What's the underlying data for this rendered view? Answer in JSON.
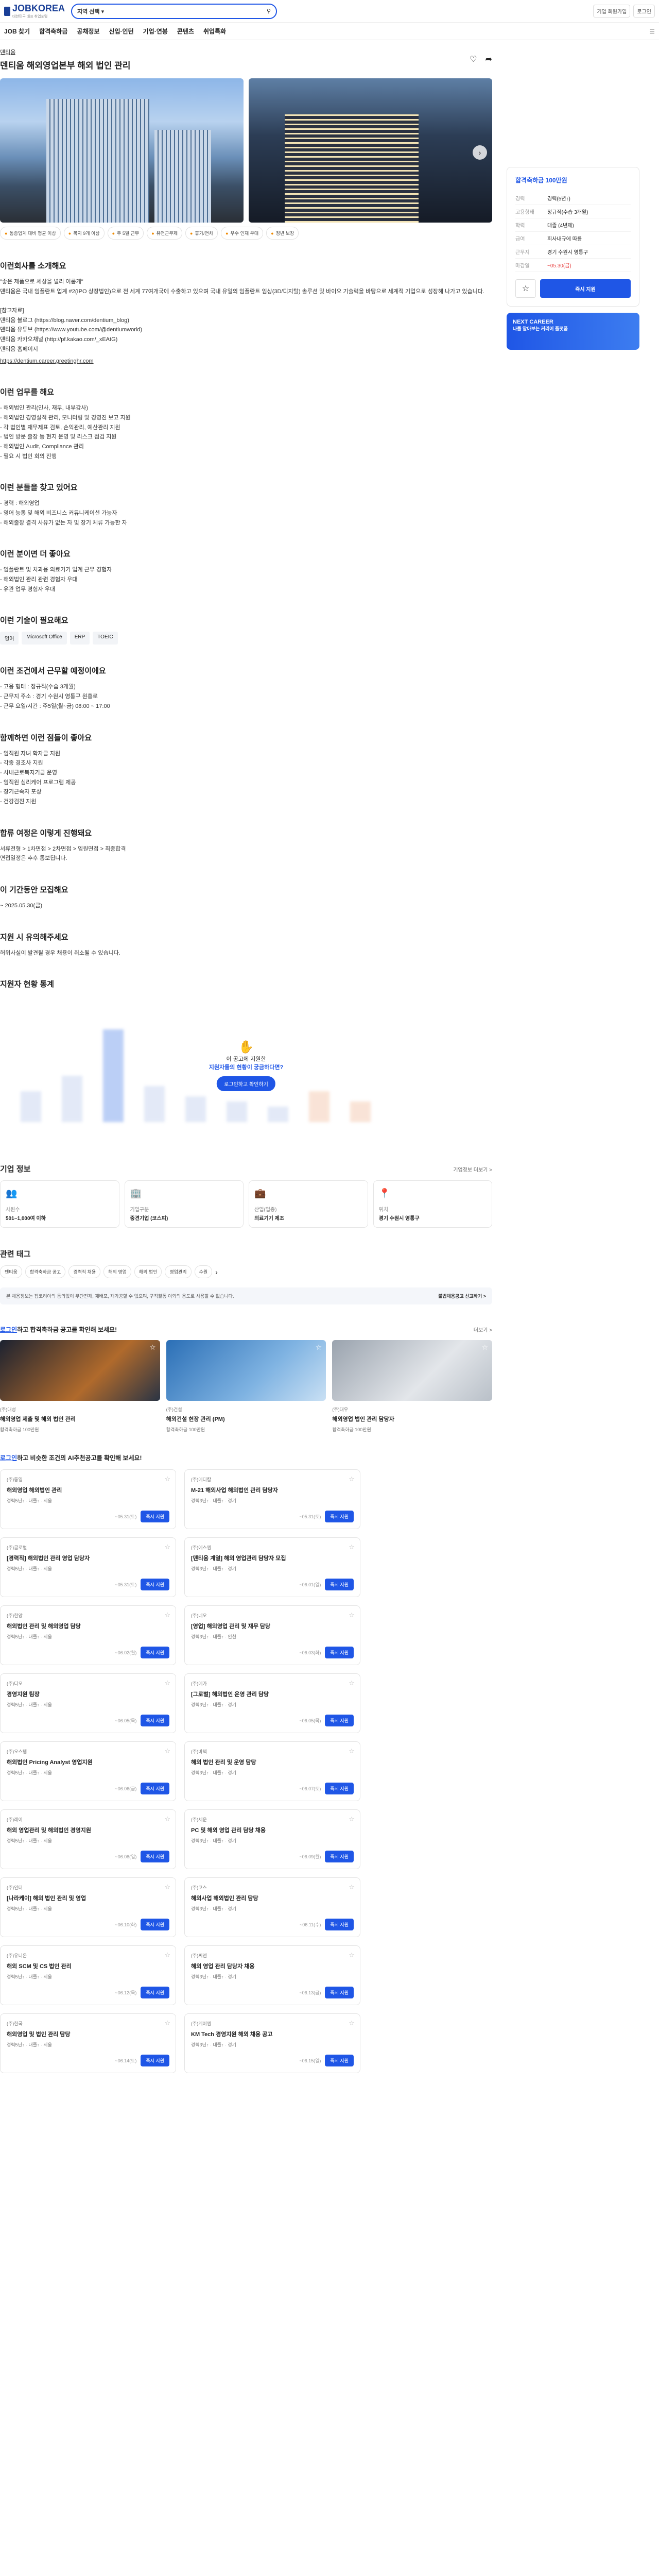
{
  "header": {
    "logo_text": "JOBKOREA",
    "logo_sub": "대한민국 대표 취업포털",
    "search_select": "지역 선택",
    "search_placeholder": "",
    "right_buttons": [
      "기업 회원가입",
      "로그인"
    ]
  },
  "gnb": [
    "JOB 찾기",
    "합격축하금",
    "공채정보",
    "신입·인턴",
    "기업·연봉",
    "콘텐츠",
    "취업특화"
  ],
  "job": {
    "company": "덴티움",
    "title": "덴티움 해외영업본부 해외 법인 관리",
    "tags": [
      "동종업계 대비 평균 이상",
      "복지 9개 이상",
      "주 5일 근무",
      "유연근무제",
      "휴가/연차",
      "우수 인재 우대",
      "정년 보장"
    ]
  },
  "summary": {
    "badge": "합격축하금 100만원",
    "rows": [
      {
        "k": "경력",
        "v": "경력(5년↑)"
      },
      {
        "k": "고용형태",
        "v": "정규직(수습 3개월)"
      },
      {
        "k": "학력",
        "v": "대졸 (4년제)"
      },
      {
        "k": "급여",
        "v": "회사내규에 따름"
      },
      {
        "k": "근무지",
        "v": "경기 수원시 영통구"
      },
      {
        "k": "마감일",
        "v": "~05.30(금)"
      }
    ],
    "apply_label": "즉시 지원",
    "banner_title": "NEXT CAREER",
    "banner_sub": "나를 알아보는 커리어 플랫폼"
  },
  "sections": {
    "intro_title": "이런회사를 소개해요",
    "intro_text": "\"좋은 제품으로 세상을 널리 이롭게\"\n덴티움은 국내 임플란트 업계 #2(IPO 상장법인)으로 전 세계 77여개국에 수출하고 있으며 국내 유일의 임플란트 임상(3D/디지털) 솔루션 및 바이오 기술력을 바탕으로 세계적 기업으로 성장해 나가고 있습니다.\n\n[참고자료]\n덴티움 블로그 (https://blog.naver.com/dentium_blog)\n덴티움 유튜브 (https://www.youtube.com/@dentiumworld)\n덴티움 카카오채널 (http://pf.kakao.com/_xEAtG)\n덴티움 홈페이지",
    "intro_link": "https://dentium.career.greetinghr.com",
    "duty_title": "이런 업무를 해요",
    "duty_text": "- 해외법인 관리(인사, 재무, 내부감사)\n - 해외법인 경영실적 관리, 모니터링 및 경영진 보고 지원\n - 각 법인별 재무제표 검토, 손익관리, 예산관리 지원\n - 법인 방문 출장 등 현지 운영 및 리스크 점검 지원\n - 해외법인 Audit, Compliance 관리\n - 필요 시 법인 회의 진행",
    "find_title": "이런 분들을 찾고 있어요",
    "find_text": "- 경력 : 해외영업\n - 영어 능통 및 해외 비즈니스 커뮤니케이션 가능자\n - 해외출장 결격 사유가 없는 자 및 장기 체류 가능한 자",
    "plus_title": "이런 분이면 더 좋아요",
    "plus_text": "- 임플란트 및 치과용 의료기기 업계 근무 경험자\n - 해외법인 관리 관련 경험자 우대\n - 유관 업무 경험자 우대",
    "skill_title": "이런 기술이 필요해요",
    "skills": [
      "영어",
      "Microsoft Office",
      "ERP",
      "TOEIC"
    ],
    "cond_title": "이런 조건에서 근무할 예정이에요",
    "cond_text": "- 고용 형태 : 정규직(수습 3개월)\n - 근무지 주소 : 경기 수원시 영통구 원흥로\n - 근무 요일/시간 : 주5일(월~금) 08:00 ~ 17:00",
    "benefit_title": "함께하면 이런 점들이 좋아요",
    "benefit_text": "- 임직원 자녀 학자금 지원\n - 각종 경조사 지원\n - 사내근로복지기금 운영\n - 임직원 심리케어 프로그램 제공\n - 장기근속자 포상\n - 건강검진 지원",
    "process_title": "합류 여정은 이렇게 진행돼요",
    "process_text": "서류전형 > 1차면접 > 2차면접 > 임원면접 > 최종합격\n면접일정은 추후 통보됩니다.",
    "deadline_title": "이 기간동안 모집해요",
    "deadline_text": "~ 2025.05.30(금)",
    "caution_title": "지원 시 유의해주세요",
    "caution_text": "허위사실이 발견될 경우 채용이 취소될 수 있습니다."
  },
  "stats": {
    "title": "지원자 현황 통계",
    "overlay_line1": "이 공고에 지원한",
    "overlay_line2": "지원자들의 현황이 궁금하다면?",
    "overlay_btn": "로그인하고 확인하기"
  },
  "company_info": {
    "title": "기업 정보",
    "more": "기업정보 더보기 >",
    "cards": [
      {
        "icon": "people-icon",
        "label": "사원수",
        "value": "501~1,000여 이하"
      },
      {
        "icon": "building-icon",
        "label": "기업구분",
        "value": "중견기업 (코스피)"
      },
      {
        "icon": "bag-icon",
        "label": "산업(업종)",
        "value": "의료기기 제조"
      },
      {
        "icon": "pin-icon",
        "label": "위치",
        "value": "경기 수원시 영통구"
      }
    ]
  },
  "related_tags": {
    "title": "관련 태그",
    "items": [
      "덴티움",
      "합격축하금 공고",
      "경력직 채용",
      "해외 영업",
      "해외 법인",
      "영업관리",
      "수원"
    ]
  },
  "notice": {
    "text": "본 채용정보는 잡코리아의 동의없이 무단전재, 재배포, 재가공할 수 없으며, 구직활동 이외의 용도로 사용할 수 없습니다.",
    "link": "불법채용공고 신고하기 >"
  },
  "reco1": {
    "login_link": "로그인",
    "suffix": "하고 합격축하금 공고를 확인해 보세요!",
    "more": "더보기 >",
    "cards": [
      {
        "company": "(주)대성",
        "title": "해외영업 제출 및 해외 법인 관리",
        "meta": "합격축하금 100만원"
      },
      {
        "company": "(주)건설",
        "title": "해외건설 현장 관리 (PM)",
        "meta": "합격축하금 100만원"
      },
      {
        "company": "(주)대우",
        "title": "해외영업 법인 관리 담당자",
        "meta": "합격축하금 100만원"
      }
    ]
  },
  "reco2": {
    "login_link": "로그인",
    "suffix": "하고 비슷한 조건의 AI추천공고를 확인해 보세요!",
    "cards": [
      {
        "company": "(주)동일",
        "title": "해외영업 해외법인 관리",
        "meta": "경력5년↑ · 대졸↑ · 서울",
        "dd": "~05.31(토)"
      },
      {
        "company": "(주)메디칼",
        "title": "M-21 해외사업 해외법인 관리 담당자",
        "meta": "경력3년↑ · 대졸↑ · 경기",
        "dd": "~05.31(토)"
      },
      {
        "company": "(주)글로벌",
        "title": "[경력직] 해외법인 관리 영업 담당자",
        "meta": "경력5년↑ · 대졸↑ · 서울",
        "dd": "~05.31(토)"
      },
      {
        "company": "(주)에스엠",
        "title": "[덴티움 계열] 해외 영업관리 담당자 모집",
        "meta": "경력3년↑ · 대졸↑ · 경기",
        "dd": "~06.01(일)"
      },
      {
        "company": "(주)한양",
        "title": "해외법인 관리 및 해외영업 담당",
        "meta": "경력5년↑ · 대졸↑ · 서울",
        "dd": "~06.02(월)"
      },
      {
        "company": "(주)네오",
        "title": "[영업] 해외영업 관리 및 재무 담당",
        "meta": "경력3년↑ · 대졸↑ · 인천",
        "dd": "~06.03(화)"
      },
      {
        "company": "(주)디오",
        "title": "경영지원 팀장",
        "meta": "경력5년↑ · 대졸↑ · 서울",
        "dd": "~06.05(목)"
      },
      {
        "company": "(주)메가",
        "title": "[그로벌] 해외법인 운영 관리 담당",
        "meta": "경력3년↑ · 대졸↑ · 경기",
        "dd": "~06.05(목)"
      },
      {
        "company": "(주)오스템",
        "title": "해외법인 Pricing Analyst 영업지원",
        "meta": "경력5년↑ · 대졸↑ · 서울",
        "dd": "~06.06(금)"
      },
      {
        "company": "(주)바텍",
        "title": "해외 법인 관리 및 운영 담당",
        "meta": "경력3년↑ · 대졸↑ · 경기",
        "dd": "~06.07(토)"
      },
      {
        "company": "(주)레이",
        "title": "해외 영업관리 및 해외법인 경영지원",
        "meta": "경력5년↑ · 대졸↑ · 서울",
        "dd": "~06.08(일)"
      },
      {
        "company": "(주)세운",
        "title": "PC 및 해외 영업 관리 담당 채용",
        "meta": "경력3년↑ · 대졸↑ · 경기",
        "dd": "~06.09(월)"
      },
      {
        "company": "(주)인터",
        "title": "[나라케이] 해외 법인 관리 및 영업",
        "meta": "경력5년↑ · 대졸↑ · 서울",
        "dd": "~06.10(화)"
      },
      {
        "company": "(주)코스",
        "title": "해외사업 해외법인 관리 담당",
        "meta": "경력3년↑ · 대졸↑ · 경기",
        "dd": "~06.11(수)"
      },
      {
        "company": "(주)유니온",
        "title": "해외 SCM 및 CS 법인 관리",
        "meta": "경력5년↑ · 대졸↑ · 서울",
        "dd": "~06.12(목)"
      },
      {
        "company": "(주)씨앤",
        "title": "해외 영업 관리 담당자 채용",
        "meta": "경력3년↑ · 대졸↑ · 경기",
        "dd": "~06.13(금)"
      },
      {
        "company": "(주)한국",
        "title": "해외영업 및 법인 관리 담당",
        "meta": "경력5년↑ · 대졸↑ · 서울",
        "dd": "~06.14(토)"
      },
      {
        "company": "(주)케이엠",
        "title": "KM Tech 경영지원 해외 채용 공고",
        "meta": "경력3년↑ · 대졸↑ · 경기",
        "dd": "~06.15(일)"
      }
    ],
    "apply_label": "즉시 지원"
  }
}
